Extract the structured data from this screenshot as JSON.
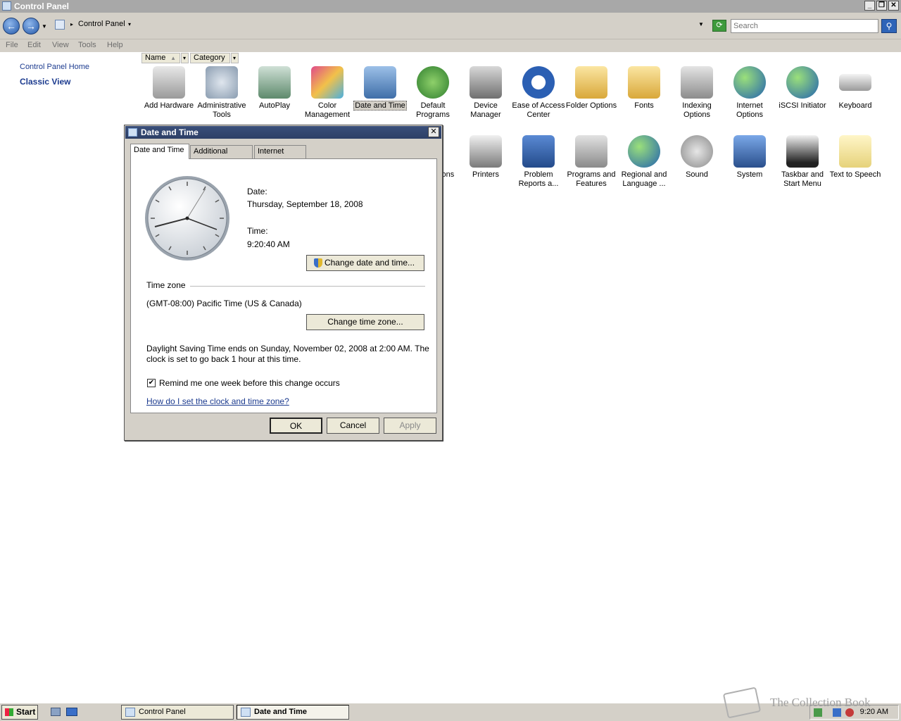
{
  "window": {
    "title": "Control Panel"
  },
  "address": {
    "location": "Control Panel",
    "search_placeholder": "Search"
  },
  "menu": [
    "File",
    "Edit",
    "View",
    "Tools",
    "Help"
  ],
  "left_pane": {
    "home_link": "Control Panel Home",
    "classic_view": "Classic View"
  },
  "columns": {
    "name": "Name",
    "category": "Category"
  },
  "items_row1": [
    "Add Hardware",
    "Administrative Tools",
    "AutoPlay",
    "Color Management",
    "Date and Time",
    "Default Programs",
    "Device Manager",
    "Ease of Access Center",
    "Folder Options",
    "Fonts",
    "Indexing Options",
    "Internet Options",
    "iSCSI Initiator",
    "Keyboard"
  ],
  "items_row2": [
    "tions",
    "Printers",
    "Problem Reports a...",
    "Programs and Features",
    "Regional and Language ...",
    "Sound",
    "System",
    "Taskbar and Start Menu",
    "Text to Speech"
  ],
  "dialog": {
    "title": "Date and Time",
    "tabs": [
      "Date and Time",
      "Additional Clocks",
      "Internet Time"
    ],
    "date_label": "Date:",
    "date_value": "Thursday, September 18, 2008",
    "time_label": "Time:",
    "time_value": "9:20:40 AM",
    "change_datetime_button": "Change date and time...",
    "timezone_heading": "Time zone",
    "timezone_value": "(GMT-08:00) Pacific Time (US & Canada)",
    "change_timezone_button": "Change time zone...",
    "dst_text_line1": "Daylight Saving Time ends on Sunday, November 02, 2008 at 2:00 AM. The",
    "dst_text_line2": "clock is set to go back 1 hour at this time.",
    "remind_checkbox": "Remind me one week before this change occurs",
    "remind_checked": true,
    "help_link": "How do I set the clock and time zone?",
    "ok": "OK",
    "cancel": "Cancel",
    "apply": "Apply"
  },
  "taskbar": {
    "start": "Start",
    "tasks": [
      "Control Panel",
      "Date and Time"
    ],
    "clock": "9:20 AM"
  },
  "watermark": "The Collection Book"
}
